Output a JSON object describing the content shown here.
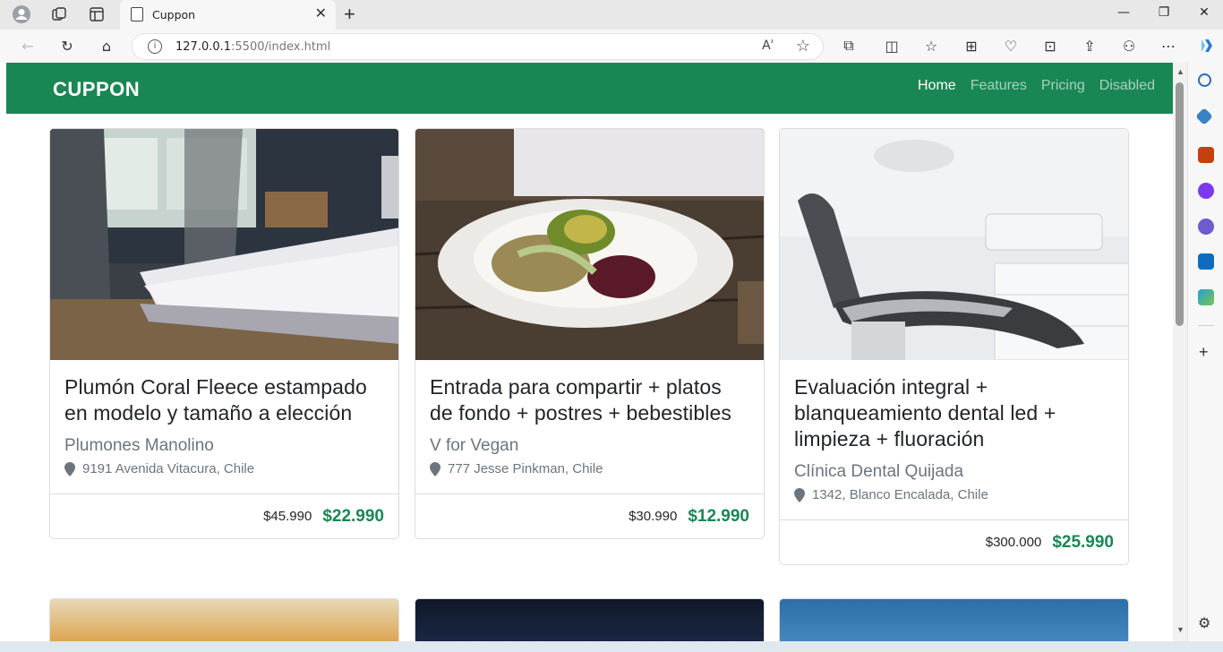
{
  "browser": {
    "tab_title": "Cuppon",
    "url_host": "127.0.0.1",
    "url_rest": ":5500/index.html",
    "read_aloud": "Aʾ"
  },
  "site": {
    "brand": "CUPPON",
    "menu": [
      {
        "label": "Home",
        "active": true
      },
      {
        "label": "Features",
        "active": false
      },
      {
        "label": "Pricing",
        "active": false
      },
      {
        "label": "Disabled",
        "active": false
      }
    ]
  },
  "cards": [
    {
      "title": "Plumón Coral Fleece estampado en modelo y tamaño a elección",
      "shop": "Plumones Manolino",
      "location": "9191 Avenida Vitacura, Chile",
      "old_price": "$45.990",
      "new_price": "$22.990"
    },
    {
      "title": "Entrada para compartir + platos de fondo + postres + bebestibles",
      "shop": "V for Vegan",
      "location": "777 Jesse Pinkman, Chile",
      "old_price": "$30.990",
      "new_price": "$12.990"
    },
    {
      "title": "Evaluación integral + blanqueamiento dental led + limpieza + fluoración",
      "shop": "Clínica Dental Quijada",
      "location": "1342, Blanco Encalada, Chile",
      "old_price": "$300.000",
      "new_price": "$25.990"
    }
  ],
  "colors": {
    "brand_green": "#198754",
    "muted": "#6c757d"
  }
}
